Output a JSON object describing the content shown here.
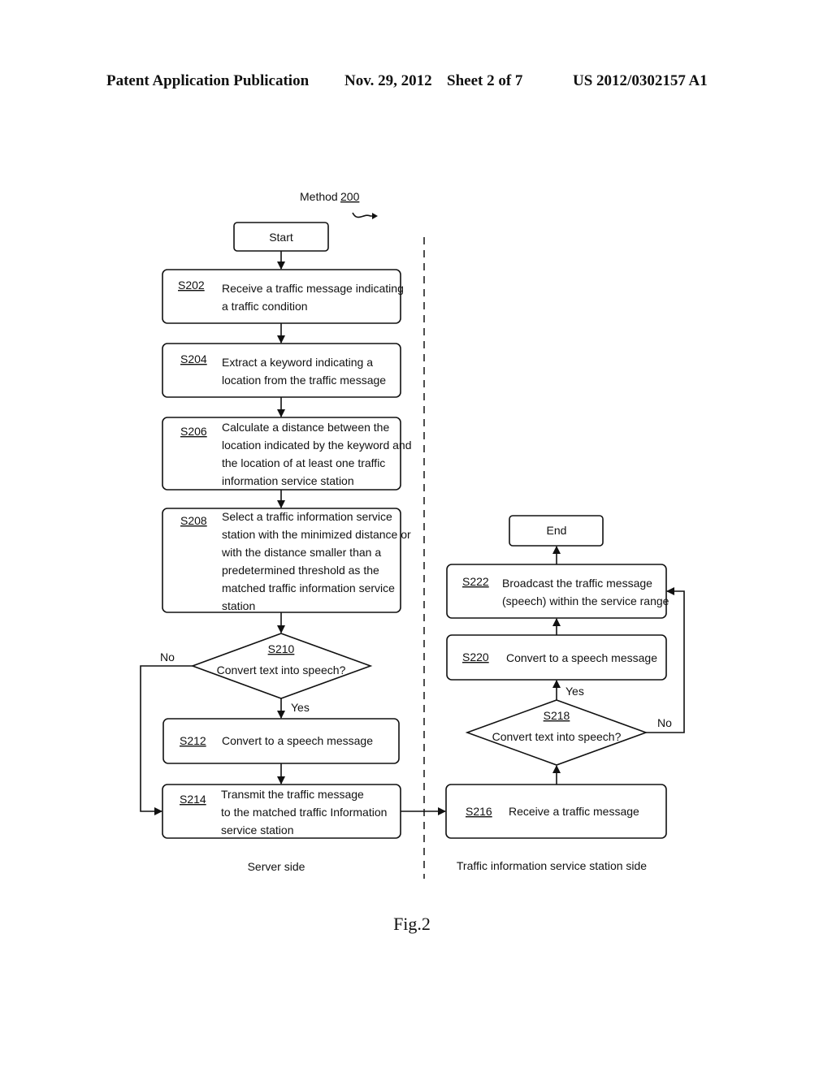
{
  "header": {
    "publication": "Patent Application Publication",
    "date": "Nov. 29, 2012",
    "sheet": "Sheet 2 of 7",
    "number": "US 2012/0302157 A1"
  },
  "method": {
    "label": "Method",
    "ref": "200"
  },
  "nodes": {
    "start": "Start",
    "end": "End",
    "s202": {
      "id": "S202",
      "lines": [
        "Receive a traffic message indicating",
        "a traffic condition"
      ]
    },
    "s204": {
      "id": "S204",
      "lines": [
        "Extract a keyword indicating a",
        "location from the traffic message"
      ]
    },
    "s206": {
      "id": "S206",
      "lines": [
        "Calculate a distance between the",
        "location indicated by the keyword and",
        "the location of at least one traffic",
        "information service station"
      ]
    },
    "s208": {
      "id": "S208",
      "lines": [
        "Select a traffic information service",
        "station with the minimized distance or",
        "with the distance smaller than a",
        "predetermined threshold as the",
        "matched traffic information service",
        "station"
      ]
    },
    "s210": {
      "id": "S210",
      "lines": [
        "Convert text into speech?"
      ]
    },
    "s212": {
      "id": "S212",
      "lines": [
        "Convert to a speech message"
      ]
    },
    "s214": {
      "id": "S214",
      "lines": [
        "Transmit the traffic message",
        "to the matched traffic Information",
        "service station"
      ]
    },
    "s216": {
      "id": "S216",
      "lines": [
        "Receive a traffic message"
      ]
    },
    "s218": {
      "id": "S218",
      "lines": [
        "Convert text into speech?"
      ]
    },
    "s220": {
      "id": "S220",
      "lines": [
        "Convert to a speech message"
      ]
    },
    "s222": {
      "id": "S222",
      "lines": [
        "Broadcast the traffic message",
        "(speech) within the service range"
      ]
    }
  },
  "edges": {
    "yes": "Yes",
    "no": "No"
  },
  "sides": {
    "server": "Server side",
    "station": "Traffic information service station side"
  },
  "figure": "Fig.2"
}
